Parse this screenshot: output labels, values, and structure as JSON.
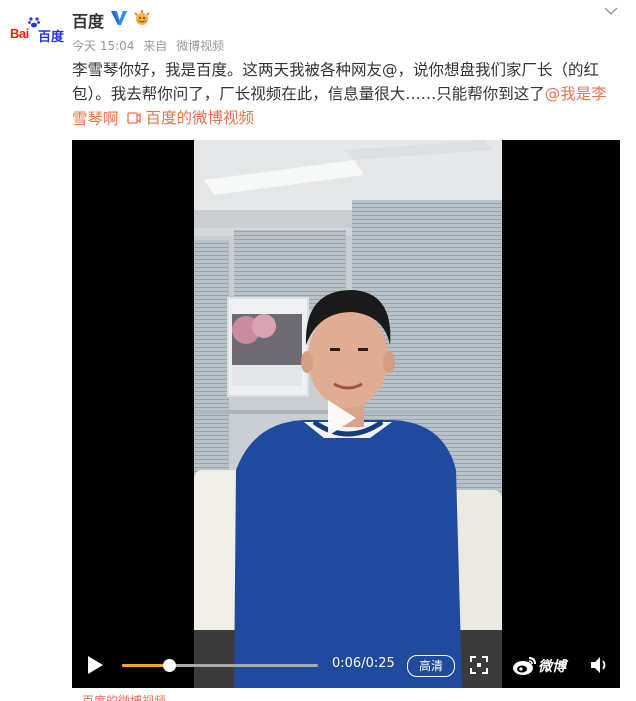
{
  "author": {
    "name": "百度",
    "logo_text_bai": "Bai",
    "logo_text_du": "百度",
    "verified_icon": "v-verified-icon",
    "badge_icon": "sun-badge-icon"
  },
  "meta": {
    "time": "今天 15:04",
    "source_prefix": "来自",
    "source": "微博视频"
  },
  "post": {
    "text": "李雪琴你好，我是百度。这两天我被各种网友@，说你想盘我们家厂长（的红包）。我去帮你问了，厂长视频在此，信息量很大……只能帮你到这了",
    "mention": "@我是李雪琴啊",
    "video_link_icon": "video-link-icon",
    "video_link_label": "百度的微博视频"
  },
  "player": {
    "progress": 0.24,
    "current_time": "0:06",
    "total_time": "0:25",
    "time_display": "0:06/0:25",
    "quality_label": "高清",
    "brand_label": "微博",
    "controls_icons": [
      "play-icon",
      "fullscreen-icon",
      "weibo-logo-icon",
      "volume-icon"
    ],
    "accent": "#f5a623"
  },
  "colors": {
    "link": "#eb7350",
    "meta": "#999999",
    "text": "#333333"
  }
}
